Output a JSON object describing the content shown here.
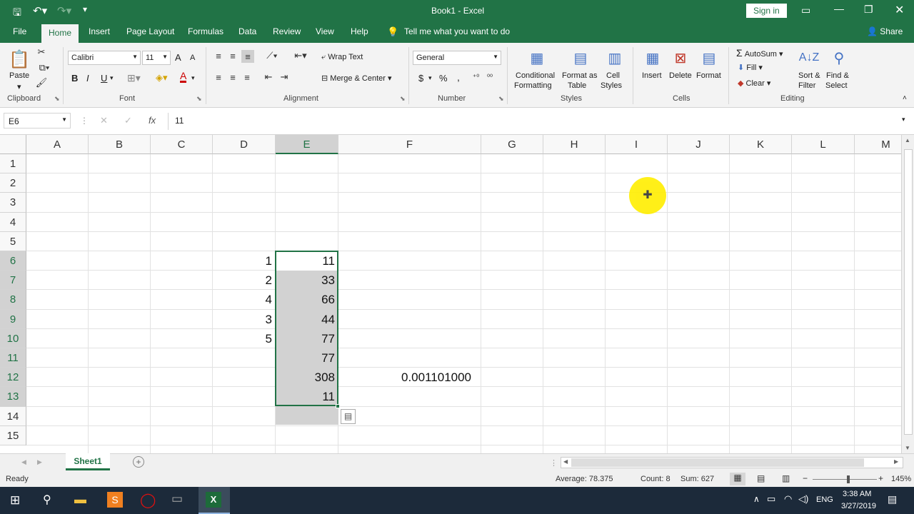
{
  "window": {
    "title": "Book1 - Excel",
    "sign_in": "Sign in"
  },
  "tabs": [
    {
      "label": "File"
    },
    {
      "label": "Home"
    },
    {
      "label": "Insert"
    },
    {
      "label": "Page Layout"
    },
    {
      "label": "Formulas"
    },
    {
      "label": "Data"
    },
    {
      "label": "Review"
    },
    {
      "label": "View"
    },
    {
      "label": "Help"
    },
    {
      "label": "Tell me what you want to do"
    },
    {
      "label": "Share"
    }
  ],
  "ribbon": {
    "clipboard": {
      "paste": "Paste",
      "label": "Clipboard"
    },
    "font": {
      "name": "Calibri",
      "size": "11",
      "label": "Font",
      "bold": "B",
      "italic": "I",
      "underline": "U",
      "grow": "A",
      "shrink": "A",
      "font_color": "A"
    },
    "alignment": {
      "wrap": "Wrap Text",
      "merge": "Merge & Center",
      "label": "Alignment"
    },
    "number": {
      "format": "General",
      "currency": "$",
      "percent": "%",
      "comma": ",",
      "label": "Number"
    },
    "styles": {
      "conditional": "Conditional",
      "conditional2": "Formatting",
      "format_table": "Format as",
      "format_table2": "Table",
      "cell_styles": "Cell",
      "cell_styles2": "Styles",
      "label": "Styles"
    },
    "cells": {
      "insert": "Insert",
      "delete": "Delete",
      "format": "Format",
      "label": "Cells"
    },
    "editing": {
      "autosum": "AutoSum",
      "fill": "Fill",
      "clear": "Clear",
      "sort": "Sort &",
      "sort2": "Filter",
      "find": "Find &",
      "find2": "Select",
      "label": "Editing"
    }
  },
  "formula_bar": {
    "name_box": "E6",
    "fx": "fx",
    "value": "11"
  },
  "columns": [
    "A",
    "B",
    "C",
    "D",
    "E",
    "F",
    "G",
    "H",
    "I",
    "J",
    "K",
    "L",
    "M"
  ],
  "rows": [
    "1",
    "2",
    "3",
    "4",
    "5",
    "6",
    "7",
    "8",
    "9",
    "10",
    "11",
    "12",
    "13",
    "14",
    "15"
  ],
  "cells": {
    "D6": "1",
    "D7": "2",
    "D8": "4",
    "D9": "3",
    "D10": "5",
    "E6": "11",
    "E7": "33",
    "E8": "66",
    "E9": "44",
    "E10": "77",
    "E11": "77",
    "E12": "308",
    "E13": "11",
    "F12": "0.001101000"
  },
  "sheet": {
    "tab": "Sheet1"
  },
  "status": {
    "ready": "Ready",
    "average": "Average: 78.375",
    "count": "Count: 8",
    "sum": "Sum: 627",
    "zoom": "145%"
  },
  "taskbar": {
    "lang": "ENG",
    "time": "3:38 AM",
    "date": "3/27/2019"
  },
  "colors": {
    "accent": "#217346",
    "selection_fill": "#d2d2d2",
    "cursor_highlight": "#ffee00"
  }
}
